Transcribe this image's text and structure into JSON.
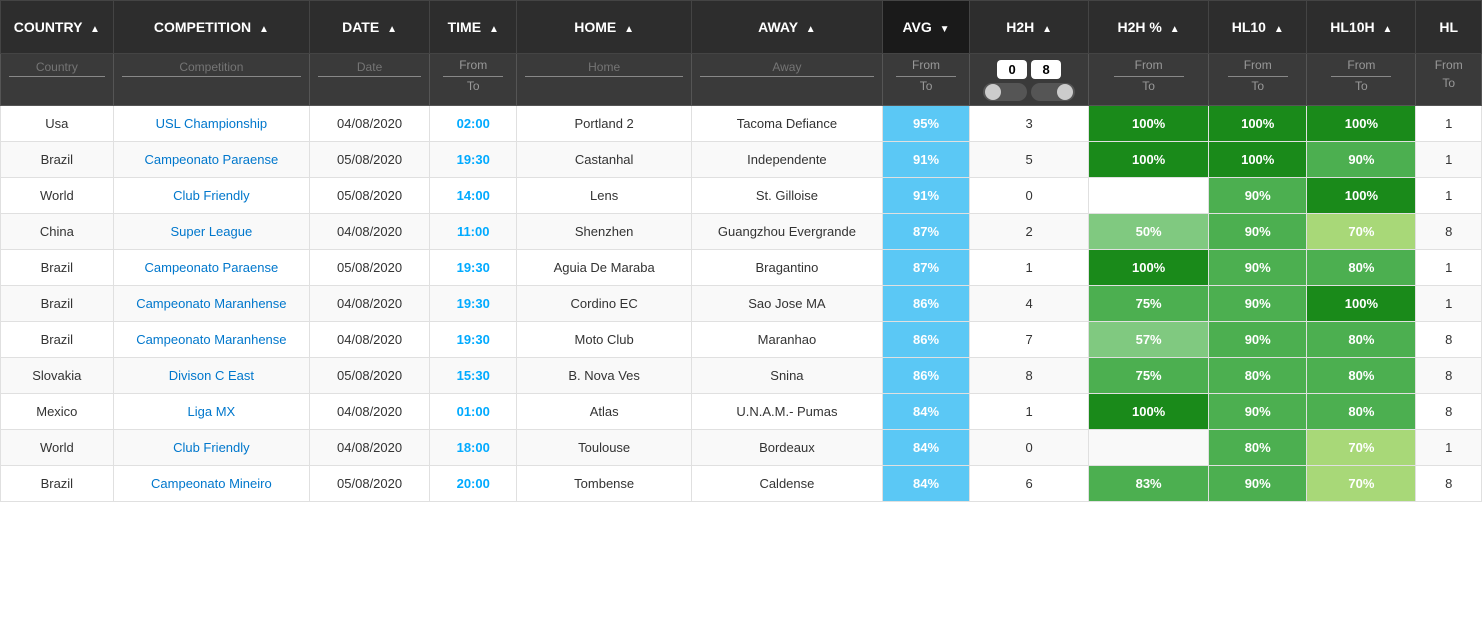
{
  "columns": [
    {
      "key": "country",
      "label": "COUNTRY",
      "sortable": true
    },
    {
      "key": "competition",
      "label": "COMPETITION",
      "sortable": true
    },
    {
      "key": "date",
      "label": "DATE",
      "sortable": true
    },
    {
      "key": "time",
      "label": "TIME",
      "sortable": true
    },
    {
      "key": "home",
      "label": "HOME",
      "sortable": true
    },
    {
      "key": "away",
      "label": "AWAY",
      "sortable": true
    },
    {
      "key": "avg",
      "label": "AVG",
      "sortable": true,
      "active": true
    },
    {
      "key": "h2h",
      "label": "H2H",
      "sortable": true
    },
    {
      "key": "h2hpct",
      "label": "H2H %",
      "sortable": true
    },
    {
      "key": "hl10",
      "label": "HL10",
      "sortable": true
    },
    {
      "key": "hl10h",
      "label": "HL10H",
      "sortable": true
    },
    {
      "key": "hl",
      "label": "HL",
      "sortable": true
    }
  ],
  "filters": {
    "country_placeholder": "Country",
    "competition_placeholder": "Competition",
    "date_placeholder": "Date",
    "home_placeholder": "Home",
    "away_placeholder": "Away",
    "from_label": "From",
    "to_label": "To",
    "h2h_from_value": "0",
    "h2h_to_value": "8"
  },
  "rows": [
    {
      "country": "Usa",
      "competition": "USL Championship",
      "date": "04/08/2020",
      "time": "02:00",
      "home": "Portland 2",
      "away": "Tacoma Defiance",
      "avg": "95%",
      "h2h": "3",
      "h2hpct": "100%",
      "h2hpct_color": "green-dark",
      "hl10": "100%",
      "hl10_color": "green-dark",
      "hl10h": "100%",
      "hl10h_color": "green-dark",
      "hl": "1",
      "hl_color": ""
    },
    {
      "country": "Brazil",
      "competition": "Campeonato Paraense",
      "date": "05/08/2020",
      "time": "19:30",
      "home": "Castanhal",
      "away": "Independente",
      "avg": "91%",
      "h2h": "5",
      "h2hpct": "100%",
      "h2hpct_color": "green-dark",
      "hl10": "100%",
      "hl10_color": "green-dark",
      "hl10h": "90%",
      "hl10h_color": "green-mid",
      "hl": "1",
      "hl_color": ""
    },
    {
      "country": "World",
      "competition": "Club Friendly",
      "date": "05/08/2020",
      "time": "14:00",
      "home": "Lens",
      "away": "St. Gilloise",
      "avg": "91%",
      "h2h": "0",
      "h2hpct": "",
      "h2hpct_color": "empty-cell",
      "hl10": "90%",
      "hl10_color": "green-mid",
      "hl10h": "100%",
      "hl10h_color": "green-dark",
      "hl": "1",
      "hl_color": ""
    },
    {
      "country": "China",
      "competition": "Super League",
      "date": "04/08/2020",
      "time": "11:00",
      "home": "Shenzhen",
      "away": "Guangzhou Evergrande",
      "avg": "87%",
      "h2h": "2",
      "h2hpct": "50%",
      "h2hpct_color": "green-light",
      "hl10": "90%",
      "hl10_color": "green-mid",
      "hl10h": "70%",
      "hl10h_color": "green-lime",
      "hl": "8",
      "hl_color": ""
    },
    {
      "country": "Brazil",
      "competition": "Campeonato Paraense",
      "date": "05/08/2020",
      "time": "19:30",
      "home": "Aguia De Maraba",
      "away": "Bragantino",
      "avg": "87%",
      "h2h": "1",
      "h2hpct": "100%",
      "h2hpct_color": "green-dark",
      "hl10": "90%",
      "hl10_color": "green-mid",
      "hl10h": "80%",
      "hl10h_color": "green-mid",
      "hl": "1",
      "hl_color": ""
    },
    {
      "country": "Brazil",
      "competition": "Campeonato Maranhense",
      "date": "04/08/2020",
      "time": "19:30",
      "home": "Cordino EC",
      "away": "Sao Jose MA",
      "avg": "86%",
      "h2h": "4",
      "h2hpct": "75%",
      "h2hpct_color": "green-mid",
      "hl10": "90%",
      "hl10_color": "green-mid",
      "hl10h": "100%",
      "hl10h_color": "green-dark",
      "hl": "1",
      "hl_color": ""
    },
    {
      "country": "Brazil",
      "competition": "Campeonato Maranhense",
      "date": "04/08/2020",
      "time": "19:30",
      "home": "Moto Club",
      "away": "Maranhao",
      "avg": "86%",
      "h2h": "7",
      "h2hpct": "57%",
      "h2hpct_color": "green-light",
      "hl10": "90%",
      "hl10_color": "green-mid",
      "hl10h": "80%",
      "hl10h_color": "green-mid",
      "hl": "8",
      "hl_color": ""
    },
    {
      "country": "Slovakia",
      "competition": "Divison C East",
      "date": "05/08/2020",
      "time": "15:30",
      "home": "B. Nova Ves",
      "away": "Snina",
      "avg": "86%",
      "h2h": "8",
      "h2hpct": "75%",
      "h2hpct_color": "green-mid",
      "hl10": "80%",
      "hl10_color": "green-mid",
      "hl10h": "80%",
      "hl10h_color": "green-mid",
      "hl": "8",
      "hl_color": ""
    },
    {
      "country": "Mexico",
      "competition": "Liga MX",
      "date": "04/08/2020",
      "time": "01:00",
      "home": "Atlas",
      "away": "U.N.A.M.- Pumas",
      "avg": "84%",
      "h2h": "1",
      "h2hpct": "100%",
      "h2hpct_color": "green-dark",
      "hl10": "90%",
      "hl10_color": "green-mid",
      "hl10h": "80%",
      "hl10h_color": "green-mid",
      "hl": "8",
      "hl_color": ""
    },
    {
      "country": "World",
      "competition": "Club Friendly",
      "date": "04/08/2020",
      "time": "18:00",
      "home": "Toulouse",
      "away": "Bordeaux",
      "avg": "84%",
      "h2h": "0",
      "h2hpct": "",
      "h2hpct_color": "empty-cell",
      "hl10": "80%",
      "hl10_color": "green-mid",
      "hl10h": "70%",
      "hl10h_color": "green-lime",
      "hl": "1",
      "hl_color": ""
    },
    {
      "country": "Brazil",
      "competition": "Campeonato Mineiro",
      "date": "05/08/2020",
      "time": "20:00",
      "home": "Tombense",
      "away": "Caldense",
      "avg": "84%",
      "h2h": "6",
      "h2hpct": "83%",
      "h2hpct_color": "green-mid",
      "hl10": "90%",
      "hl10_color": "green-mid",
      "hl10h": "70%",
      "hl10h_color": "green-lime",
      "hl": "8",
      "hl_color": ""
    }
  ]
}
